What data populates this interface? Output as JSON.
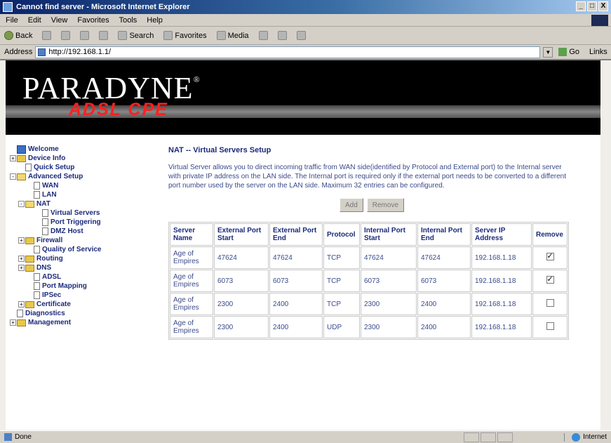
{
  "window": {
    "title": "Cannot find server - Microsoft Internet Explorer",
    "controls": [
      "_",
      "□",
      "X"
    ]
  },
  "menu": [
    "File",
    "Edit",
    "View",
    "Favorites",
    "Tools",
    "Help"
  ],
  "toolbar": {
    "back": "Back",
    "search": "Search",
    "favorites": "Favorites",
    "media": "Media"
  },
  "address": {
    "label": "Address",
    "url": "http://192.168.1.1/",
    "go": "Go",
    "links": "Links"
  },
  "header": {
    "brand": "PARADYNE",
    "trademark": "®",
    "product": "ADSL CPE"
  },
  "tree": [
    {
      "label": "Welcome",
      "depth": 0,
      "icon": "globe",
      "exp": "",
      "bold": true
    },
    {
      "label": "Device Info",
      "depth": 0,
      "icon": "folder",
      "exp": "+",
      "bold": true
    },
    {
      "label": "Quick Setup",
      "depth": 1,
      "icon": "page",
      "exp": "",
      "bold": true
    },
    {
      "label": "Advanced Setup",
      "depth": 0,
      "icon": "folder-open",
      "exp": "-",
      "bold": true
    },
    {
      "label": "WAN",
      "depth": 2,
      "icon": "page",
      "exp": "",
      "bold": true
    },
    {
      "label": "LAN",
      "depth": 2,
      "icon": "page",
      "exp": "",
      "bold": true
    },
    {
      "label": "NAT",
      "depth": 1,
      "icon": "folder-open",
      "exp": "-",
      "bold": true
    },
    {
      "label": "Virtual Servers",
      "depth": 3,
      "icon": "page",
      "exp": "",
      "bold": true
    },
    {
      "label": "Port Triggering",
      "depth": 3,
      "icon": "page",
      "exp": "",
      "bold": true
    },
    {
      "label": "DMZ Host",
      "depth": 3,
      "icon": "page",
      "exp": "",
      "bold": true
    },
    {
      "label": "Firewall",
      "depth": 1,
      "icon": "folder",
      "exp": "+",
      "bold": true
    },
    {
      "label": "Quality of Service",
      "depth": 2,
      "icon": "page",
      "exp": "",
      "bold": true
    },
    {
      "label": "Routing",
      "depth": 1,
      "icon": "folder",
      "exp": "+",
      "bold": true
    },
    {
      "label": "DNS",
      "depth": 1,
      "icon": "folder",
      "exp": "+",
      "bold": true
    },
    {
      "label": "ADSL",
      "depth": 2,
      "icon": "page",
      "exp": "",
      "bold": true
    },
    {
      "label": "Port Mapping",
      "depth": 2,
      "icon": "page",
      "exp": "",
      "bold": true
    },
    {
      "label": "IPSec",
      "depth": 2,
      "icon": "page",
      "exp": "",
      "bold": true
    },
    {
      "label": "Certificate",
      "depth": 1,
      "icon": "folder",
      "exp": "+",
      "bold": true
    },
    {
      "label": "Diagnostics",
      "depth": 0,
      "icon": "page",
      "exp": "",
      "bold": true
    },
    {
      "label": "Management",
      "depth": 0,
      "icon": "folder",
      "exp": "+",
      "bold": true
    }
  ],
  "main": {
    "title": "NAT -- Virtual Servers Setup",
    "description": "Virtual Server allows you to direct incoming traffic from WAN side(identified by Protocol and External port) to the Internal server with private IP address on the LAN side. The Internal port is required only if the external port needs to be converted to a different port number used by the server on the LAN side. Maximum 32 entries can be configured.",
    "add_label": "Add",
    "remove_label": "Remove"
  },
  "table": {
    "headers": [
      "Server Name",
      "External Port Start",
      "External Port End",
      "Protocol",
      "Internal Port Start",
      "Internal Port End",
      "Server IP Address",
      "Remove"
    ],
    "rows": [
      {
        "name": "Age of Empires",
        "ext_start": "47624",
        "ext_end": "47624",
        "protocol": "TCP",
        "int_start": "47624",
        "int_end": "47624",
        "ip": "192.168.1.18",
        "remove": true
      },
      {
        "name": "Age of Empires",
        "ext_start": "6073",
        "ext_end": "6073",
        "protocol": "TCP",
        "int_start": "6073",
        "int_end": "6073",
        "ip": "192.168.1.18",
        "remove": true
      },
      {
        "name": "Age of Empires",
        "ext_start": "2300",
        "ext_end": "2400",
        "protocol": "TCP",
        "int_start": "2300",
        "int_end": "2400",
        "ip": "192.168.1.18",
        "remove": false
      },
      {
        "name": "Age of Empires",
        "ext_start": "2300",
        "ext_end": "2400",
        "protocol": "UDP",
        "int_start": "2300",
        "int_end": "2400",
        "ip": "192.168.1.18",
        "remove": false
      }
    ]
  },
  "status": {
    "left": "Done",
    "right": "Internet"
  }
}
